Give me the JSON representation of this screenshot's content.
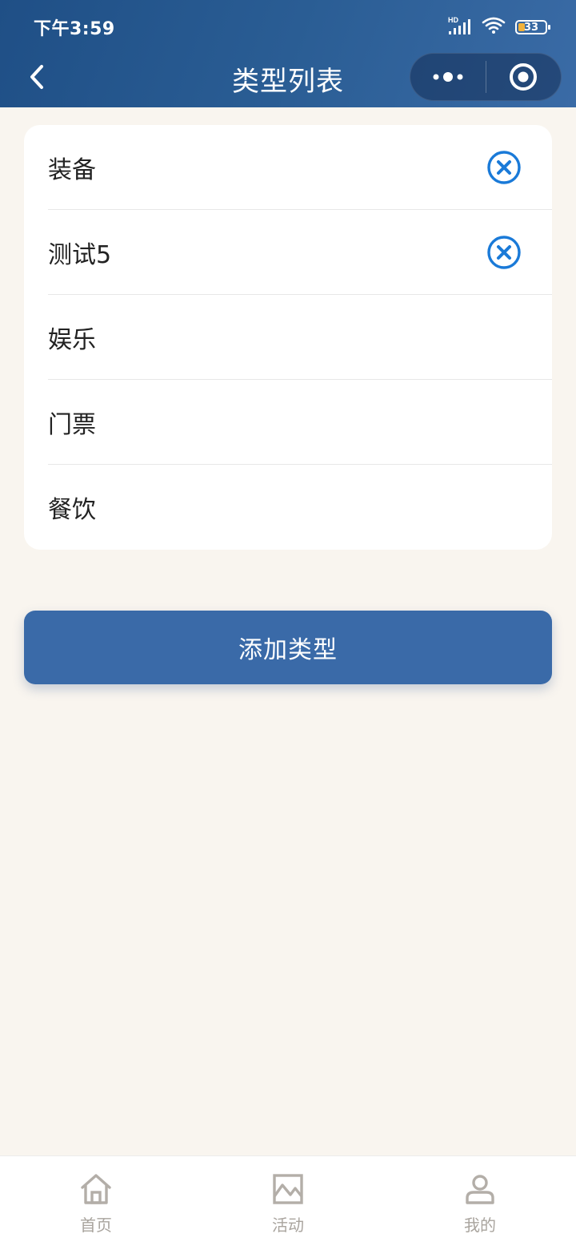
{
  "status_bar": {
    "time": "下午3:59",
    "network_label": "HD",
    "battery_level": "33"
  },
  "nav": {
    "title": "类型列表"
  },
  "types": [
    {
      "label": "装备",
      "deletable": true
    },
    {
      "label": "测试5",
      "deletable": true
    },
    {
      "label": "娱乐",
      "deletable": false
    },
    {
      "label": "门票",
      "deletable": false
    },
    {
      "label": "餐饮",
      "deletable": false
    }
  ],
  "add_button_label": "添加类型",
  "tabbar": {
    "items": [
      {
        "label": "首页",
        "icon": "home-icon"
      },
      {
        "label": "活动",
        "icon": "activity-chart-icon"
      },
      {
        "label": "我的",
        "icon": "user-icon"
      }
    ]
  },
  "colors": {
    "header_gradient_start": "#1f4f86",
    "header_gradient_end": "#3a6ba6",
    "accent_blue": "#1a7ad8",
    "button_blue": "#3a6aa8",
    "page_background": "#f9f5ef",
    "tab_inactive": "#a9a49e"
  }
}
